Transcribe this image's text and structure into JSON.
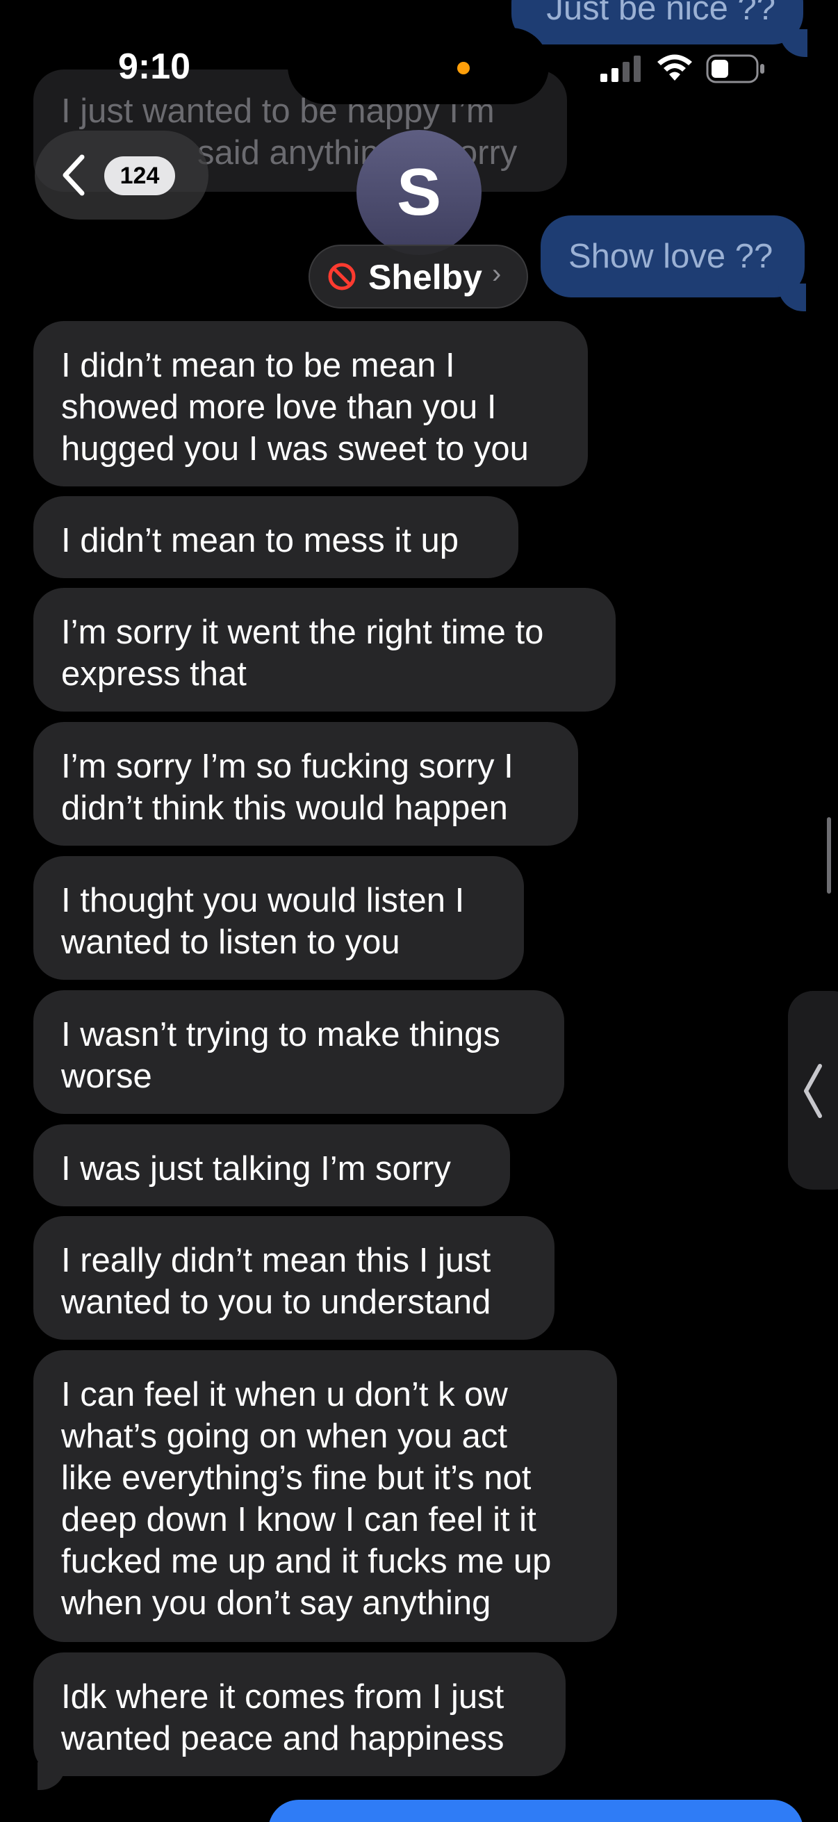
{
  "status_bar": {
    "time": "9:10"
  },
  "header": {
    "back_count": "124",
    "avatar_initial": "S",
    "contact_name": "Shelby"
  },
  "messages_top": {
    "outgoing_top": "Just be nice ??",
    "incoming_faded": "I just wanted to be happy I’m\n    said anything  sorry",
    "outgoing_show_love": "Show love ??"
  },
  "messages": [
    "I didn’t mean to be mean I\nshowed more love than you I\nhugged you I was sweet to you",
    "I didn’t mean to mess it up",
    "I’m sorry it went the right time to\nexpress that",
    "I’m sorry I’m so fucking sorry I\ndidn’t think this would happen",
    "I thought you would listen I\nwanted to listen to you",
    "I wasn’t trying to make things\nworse",
    "I was just talking I’m sorry",
    "I really didn’t mean this I just\nwanted to you to understand",
    "I can feel it when u don’t k ow\nwhat’s going on when you act\nlike everything’s fine but it’s not\ndeep down I know I can feel it it\nfucked me up and it fucks me up\nwhen you don’t say anything",
    "Idk where it comes from I just\nwanted peace and happiness"
  ],
  "colors": {
    "incoming_bubble": "#262628",
    "outgoing_bubble": "#1e3d73",
    "accent_blue": "#2f7cf6",
    "blocked_red": "#ff3b30"
  }
}
